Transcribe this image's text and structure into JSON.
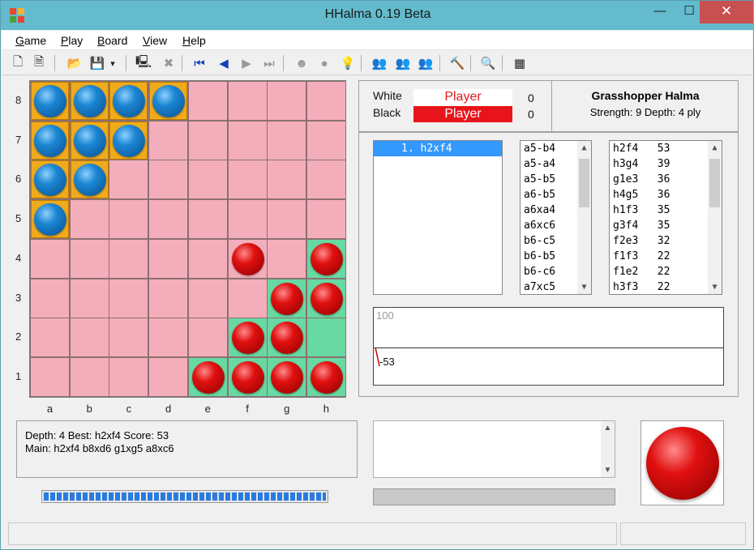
{
  "window": {
    "title": "HHalma 0.19 Beta",
    "minimize_symbol": "—",
    "maximize_symbol": "☐",
    "close_symbol": "✕",
    "app_icon_colors": [
      "#e5492d",
      "#f3b23a",
      "#4d9e3b",
      "#e5492d"
    ]
  },
  "menu": {
    "items": [
      "Game",
      "Play",
      "Board",
      "View",
      "Help"
    ]
  },
  "toolbar": {
    "buttons": [
      {
        "name": "new-game-icon",
        "glyph": "🗋"
      },
      {
        "name": "new-position-icon",
        "glyph": "🗎"
      },
      {
        "name": "open-icon",
        "glyph": "📂"
      },
      {
        "name": "save-icon",
        "glyph": "💾"
      },
      {
        "name": "save-dropdown-icon",
        "glyph": "▾"
      },
      {
        "name": "computer-icon",
        "glyph": "🖳"
      },
      {
        "name": "stop-icon",
        "glyph": "✖"
      },
      {
        "name": "first-move-icon",
        "glyph": "⏮"
      },
      {
        "name": "previous-move-icon",
        "glyph": "◀"
      },
      {
        "name": "next-move-icon",
        "glyph": "▶"
      },
      {
        "name": "last-move-icon",
        "glyph": "⏭"
      },
      {
        "name": "mask-icon",
        "glyph": "☻"
      },
      {
        "name": "circle-icon",
        "glyph": "●"
      },
      {
        "name": "hint-bulb-icon",
        "glyph": "💡"
      },
      {
        "name": "human-vs-human-icon",
        "glyph": "👥"
      },
      {
        "name": "human-vs-computer-icon",
        "glyph": "👥"
      },
      {
        "name": "computer-vs-computer-icon",
        "glyph": "👥"
      },
      {
        "name": "hammer-icon",
        "glyph": "🔨"
      },
      {
        "name": "magnifier-icon",
        "glyph": "🔍"
      },
      {
        "name": "checkerboard-icon",
        "glyph": "▦"
      }
    ]
  },
  "board": {
    "files": [
      "a",
      "b",
      "c",
      "d",
      "e",
      "f",
      "g",
      "h"
    ],
    "ranks": [
      "8",
      "7",
      "6",
      "5",
      "4",
      "3",
      "2",
      "1"
    ],
    "colors": {
      "pink": "#f4aebb",
      "green": "#68d9a2",
      "gold": "#f0ab1d"
    },
    "cells": [
      [
        "gold:blue",
        "gold:blue",
        "gold:blue",
        "gold:blue",
        "pink:",
        "pink:",
        "pink:",
        "pink:"
      ],
      [
        "gold:blue",
        "gold:blue",
        "gold:blue",
        "pink:",
        "pink:",
        "pink:",
        "pink:",
        "pink:"
      ],
      [
        "gold:blue",
        "gold:blue",
        "pink:",
        "pink:",
        "pink:",
        "pink:",
        "pink:",
        "pink:"
      ],
      [
        "gold:blue",
        "pink:",
        "pink:",
        "pink:",
        "pink:",
        "pink:",
        "pink:",
        "pink:"
      ],
      [
        "pink:",
        "pink:",
        "pink:",
        "pink:",
        "pink:",
        "pink:red",
        "pink:",
        "green:red"
      ],
      [
        "pink:",
        "pink:",
        "pink:",
        "pink:",
        "pink:",
        "pink:",
        "green:red",
        "green:red"
      ],
      [
        "pink:",
        "pink:",
        "pink:",
        "pink:",
        "pink:",
        "green:red",
        "green:red",
        "green:"
      ],
      [
        "pink:",
        "pink:",
        "pink:",
        "pink:",
        "green:red",
        "green:red",
        "green:red",
        "green:red"
      ]
    ]
  },
  "players": {
    "white_label": "White",
    "black_label": "Black",
    "white_name": "Player",
    "black_name": "Player",
    "white_score": "0",
    "black_score": "0",
    "engine_name": "Grasshopper Halma",
    "engine_info": "Strength: 9   Depth: 4 ply"
  },
  "move_history": [
    "1. h2xf4"
  ],
  "legal_moves": [
    "a5-b4",
    "a5-a4",
    "a5-b5",
    "a6-b5",
    "a6xa4",
    "a6xc6",
    "b6-c5",
    "b6-b5",
    "b6-c6",
    "a7xc5"
  ],
  "evaluations": [
    {
      "move": "h2f4",
      "score": "53"
    },
    {
      "move": "h3g4",
      "score": "39"
    },
    {
      "move": "g1e3",
      "score": "36"
    },
    {
      "move": "h4g5",
      "score": "36"
    },
    {
      "move": "h1f3",
      "score": "35"
    },
    {
      "move": "g3f4",
      "score": "35"
    },
    {
      "move": "f2e3",
      "score": "32"
    },
    {
      "move": "f1f3",
      "score": "22"
    },
    {
      "move": "f1e2",
      "score": "22"
    },
    {
      "move": "h3f3",
      "score": "22"
    }
  ],
  "graph": {
    "top_label": "100",
    "bottom_label": "-53"
  },
  "search_info": {
    "line1": "Depth: 4   Best: h2xf4   Score: 53",
    "line2": "Main: h2xf4 b8xd6 g1xg5 a8xc6"
  },
  "progress": {
    "fraction": 1.0
  },
  "turn": {
    "color": "red"
  }
}
